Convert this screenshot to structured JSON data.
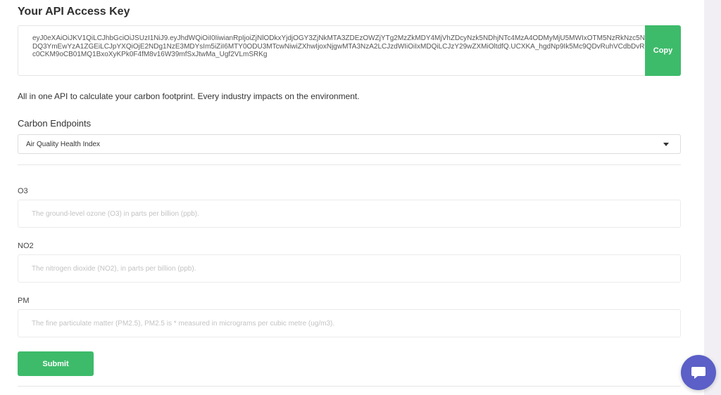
{
  "header": {
    "title": "Your API Access Key"
  },
  "api_key": {
    "value": "eyJ0eXAiOiJKV1QiLCJhbGciOiJSUzI1NiJ9.eyJhdWQiOiI0IiwianRpIjoiZjNlODkxYjdjOGY3ZjNkMTA3ZDEzOWZjYTg2MzZkMDY4MjVhZDcyNzk5NDhjNTc4MzA4ODMyMjU5MWIxOTM5NzRkNzc5NDQ3YmEwYzA1ZGEiLCJpYXQiOjE2NDg1NzE3MDYsIm5iZiI6MTY0ODU3MTcwNiwiZXhwIjoxNjgwMTA3NzA2LCJzdWIiOiIxMDQiLCJzY29wZXMiOltdfQ.UCXKA_hgdNp9Ik5Mc9QDvRuhVCdbDvRc0CKM9oCB01MQ1BxoXyKPk0F4fM8v16W39mfSxJtwMa_Ugf2VLmSRKg",
    "copy_label": "Copy"
  },
  "description": "All in one API to calculate your carbon footprint. Every industry impacts on the environment.",
  "endpoints": {
    "label": "Carbon Endpoints",
    "selected": "Air Quality Health Index"
  },
  "fields": [
    {
      "label": "O3",
      "placeholder": "The ground-level ozone (O3) in parts per billion (ppb)."
    },
    {
      "label": "NO2",
      "placeholder": "The nitrogen dioxide (NO2), in parts per billion (ppb)."
    },
    {
      "label": "PM",
      "placeholder": "The fine particulate matter (PM2.5), PM2.5 is * measured in micrograms per cubic metre (ug/m3)."
    }
  ],
  "submit_label": "Submit",
  "colors": {
    "accent_green": "#3dbb6a",
    "chat_purple": "#5b5fc7"
  },
  "icons": {
    "select_caret": "caret-down-icon",
    "chat": "chat-bubble-icon"
  }
}
